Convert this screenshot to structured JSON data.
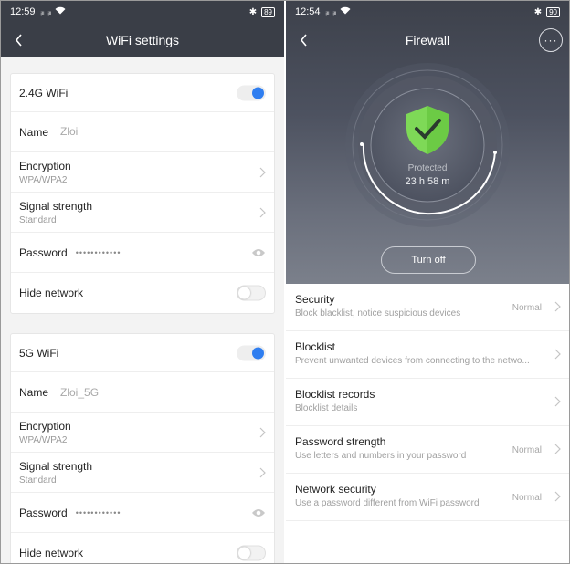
{
  "left": {
    "status": {
      "time": "12:59",
      "signal1": "ᵢₗₗ",
      "signal2": "ᵢₗₗ",
      "battery": "89"
    },
    "title": "WiFi settings",
    "band24": {
      "header": "2.4G WiFi",
      "name_label": "Name",
      "name_value": "Zloi",
      "encryption_label": "Encryption",
      "encryption_value": "WPA/WPA2",
      "signal_label": "Signal strength",
      "signal_value": "Standard",
      "password_label": "Password",
      "password_value": "••••••••••••",
      "hide_label": "Hide network"
    },
    "band5": {
      "header": "5G WiFi",
      "name_label": "Name",
      "name_value": "Zloi_5G",
      "encryption_label": "Encryption",
      "encryption_value": "WPA/WPA2",
      "signal_label": "Signal strength",
      "signal_value": "Standard",
      "password_label": "Password",
      "password_value": "••••••••••••",
      "hide_label": "Hide network"
    }
  },
  "right": {
    "status": {
      "time": "12:54",
      "signal1": "ᵢₗₗ",
      "signal2": "ᵢₗₗ",
      "battery": "90"
    },
    "title": "Firewall",
    "more_label": "···",
    "protected_label": "Protected",
    "protected_time": "23 h 58 m",
    "turn_off": "Turn off",
    "items": [
      {
        "title": "Security",
        "desc": "Block blacklist, notice suspicious devices",
        "state": "Normal"
      },
      {
        "title": "Blocklist",
        "desc": "Prevent unwanted devices from connecting to the netwo...",
        "state": ""
      },
      {
        "title": "Blocklist records",
        "desc": "Blocklist details",
        "state": ""
      },
      {
        "title": "Password strength",
        "desc": "Use letters and numbers in your password",
        "state": "Normal"
      },
      {
        "title": "Network security",
        "desc": "Use a password different from WiFi password",
        "state": "Normal"
      }
    ]
  },
  "colors": {
    "accent": "#2f7ef0",
    "shield": "#7ed957",
    "header_bg": "#3a3e47"
  }
}
